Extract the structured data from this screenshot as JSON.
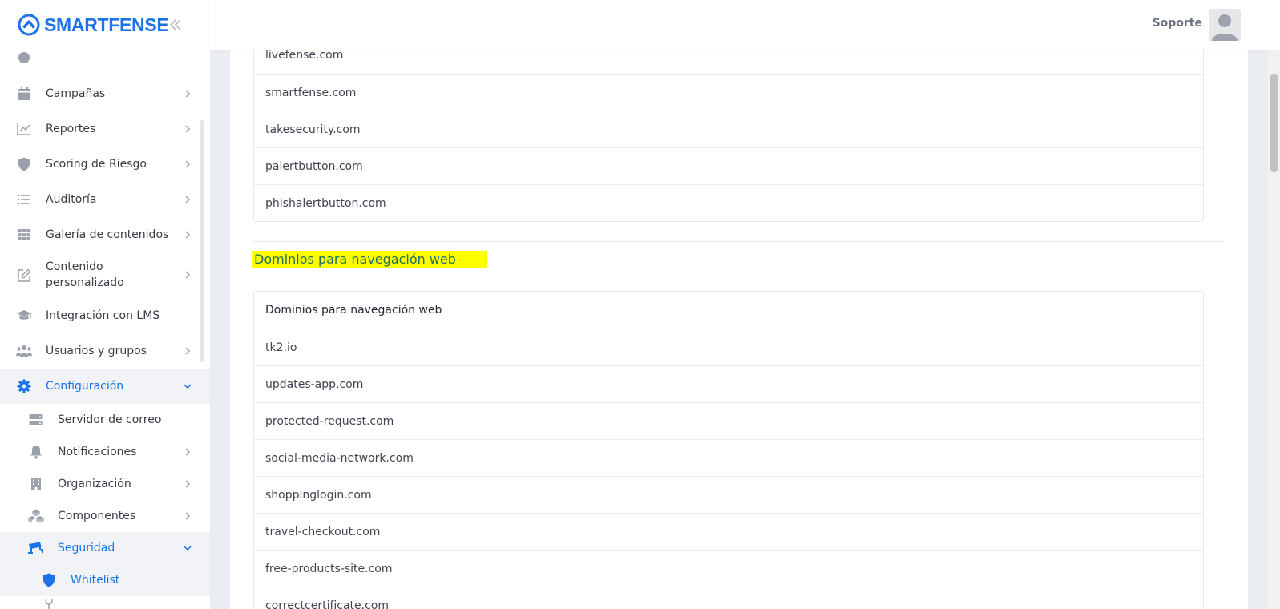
{
  "brand": {
    "name": "SMARTFENSE"
  },
  "header": {
    "user_name": "Soporte"
  },
  "sidebar": {
    "items": [
      {
        "label": "Campañas"
      },
      {
        "label": "Reportes"
      },
      {
        "label": "Scoring de Riesgo"
      },
      {
        "label": "Auditoría"
      },
      {
        "label": "Galería de contenidos"
      },
      {
        "label": "Contenido personalizado"
      },
      {
        "label": "Integración con LMS"
      },
      {
        "label": "Usuarios y grupos"
      },
      {
        "label": "Configuración"
      }
    ],
    "config_children": [
      {
        "label": "Servidor de correo"
      },
      {
        "label": "Notificaciones"
      },
      {
        "label": "Organización"
      },
      {
        "label": "Componentes"
      },
      {
        "label": "Seguridad"
      }
    ],
    "security_children": [
      {
        "label": "Whitelist"
      }
    ]
  },
  "main": {
    "list1": [
      "livefense.com",
      "smartfense.com",
      "takesecurity.com",
      "palertbutton.com",
      "phishalertbutton.com"
    ],
    "section_title": "Dominios para navegación web",
    "list2_header": "Dominios para navegación web",
    "list2": [
      "tk2.io",
      "updates-app.com",
      "protected-request.com",
      "social-media-network.com",
      "shoppinglogin.com",
      "travel-checkout.com",
      "free-products-site.com",
      "correctcertificate.com"
    ]
  },
  "colors": {
    "accent": "#1a73e8",
    "highlight": "#ffff00",
    "icon_gray": "#9aa1ab"
  }
}
